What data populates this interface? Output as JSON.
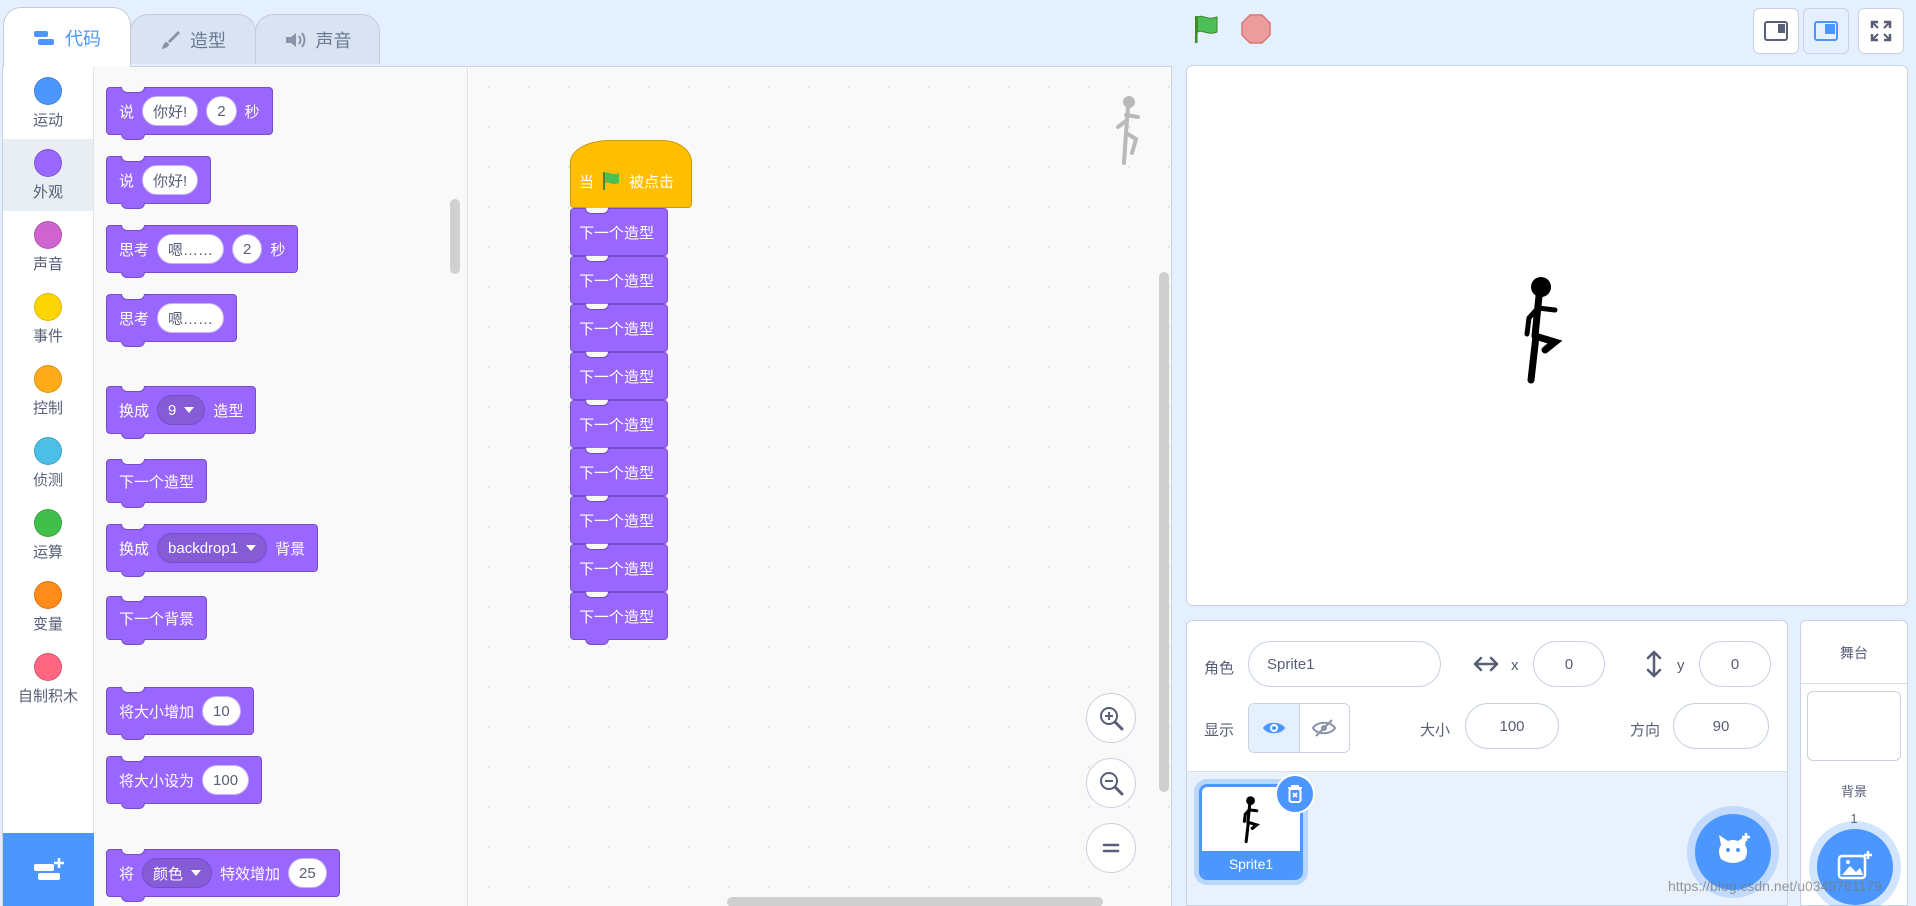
{
  "tabs": {
    "code": "代码",
    "costumes": "造型",
    "sounds": "声音"
  },
  "categories": [
    {
      "label": "运动",
      "color": "#4c97ff"
    },
    {
      "label": "外观",
      "color": "#9966ff"
    },
    {
      "label": "声音",
      "color": "#cf63cf"
    },
    {
      "label": "事件",
      "color": "#ffd500"
    },
    {
      "label": "控制",
      "color": "#ffab19"
    },
    {
      "label": "侦测",
      "color": "#4cbfe6"
    },
    {
      "label": "运算",
      "color": "#40bf4a"
    },
    {
      "label": "变量",
      "color": "#ff8c1a"
    },
    {
      "label": "自制积木",
      "color": "#ff6680"
    }
  ],
  "palette": {
    "say_secs": {
      "say": "说",
      "msg": "你好!",
      "secs": "2",
      "unit": "秒"
    },
    "say": {
      "say": "说",
      "msg": "你好!"
    },
    "think_secs": {
      "think": "思考",
      "msg": "嗯……",
      "secs": "2",
      "unit": "秒"
    },
    "think": {
      "think": "思考",
      "msg": "嗯……"
    },
    "switch_costume": {
      "prefix": "换成",
      "value": "9",
      "suffix": "造型"
    },
    "next_costume": "下一个造型",
    "switch_backdrop": {
      "prefix": "换成",
      "value": "backdrop1",
      "suffix": "背景"
    },
    "next_backdrop": "下一个背景",
    "change_size": {
      "label": "将大小增加",
      "value": "10"
    },
    "set_size": {
      "label": "将大小设为",
      "value": "100"
    },
    "change_effect": {
      "prefix": "将",
      "effect": "颜色",
      "middle": "特效增加",
      "value": "25"
    }
  },
  "script": {
    "hat": {
      "prefix": "当",
      "suffix": "被点击"
    },
    "blocks": [
      "下一个造型",
      "下一个造型",
      "下一个造型",
      "下一个造型",
      "下一个造型",
      "下一个造型",
      "下一个造型",
      "下一个造型",
      "下一个造型"
    ]
  },
  "sprite": {
    "sprite_label": "角色",
    "name": "Sprite1",
    "x_label": "x",
    "x": "0",
    "y_label": "y",
    "y": "0",
    "show_label": "显示",
    "size_label": "大小",
    "size": "100",
    "direction_label": "方向",
    "direction": "90"
  },
  "sprite_list": [
    {
      "name": "Sprite1"
    }
  ],
  "stage_pane": {
    "title": "舞台",
    "backdrops_label": "背景",
    "backdrops_count": "1"
  },
  "watermark": "https://blog.csdn.net/u0349781179",
  "colors": {
    "accent": "#4c97ff",
    "looks": "#9966ff",
    "events": "#ffbf00"
  }
}
